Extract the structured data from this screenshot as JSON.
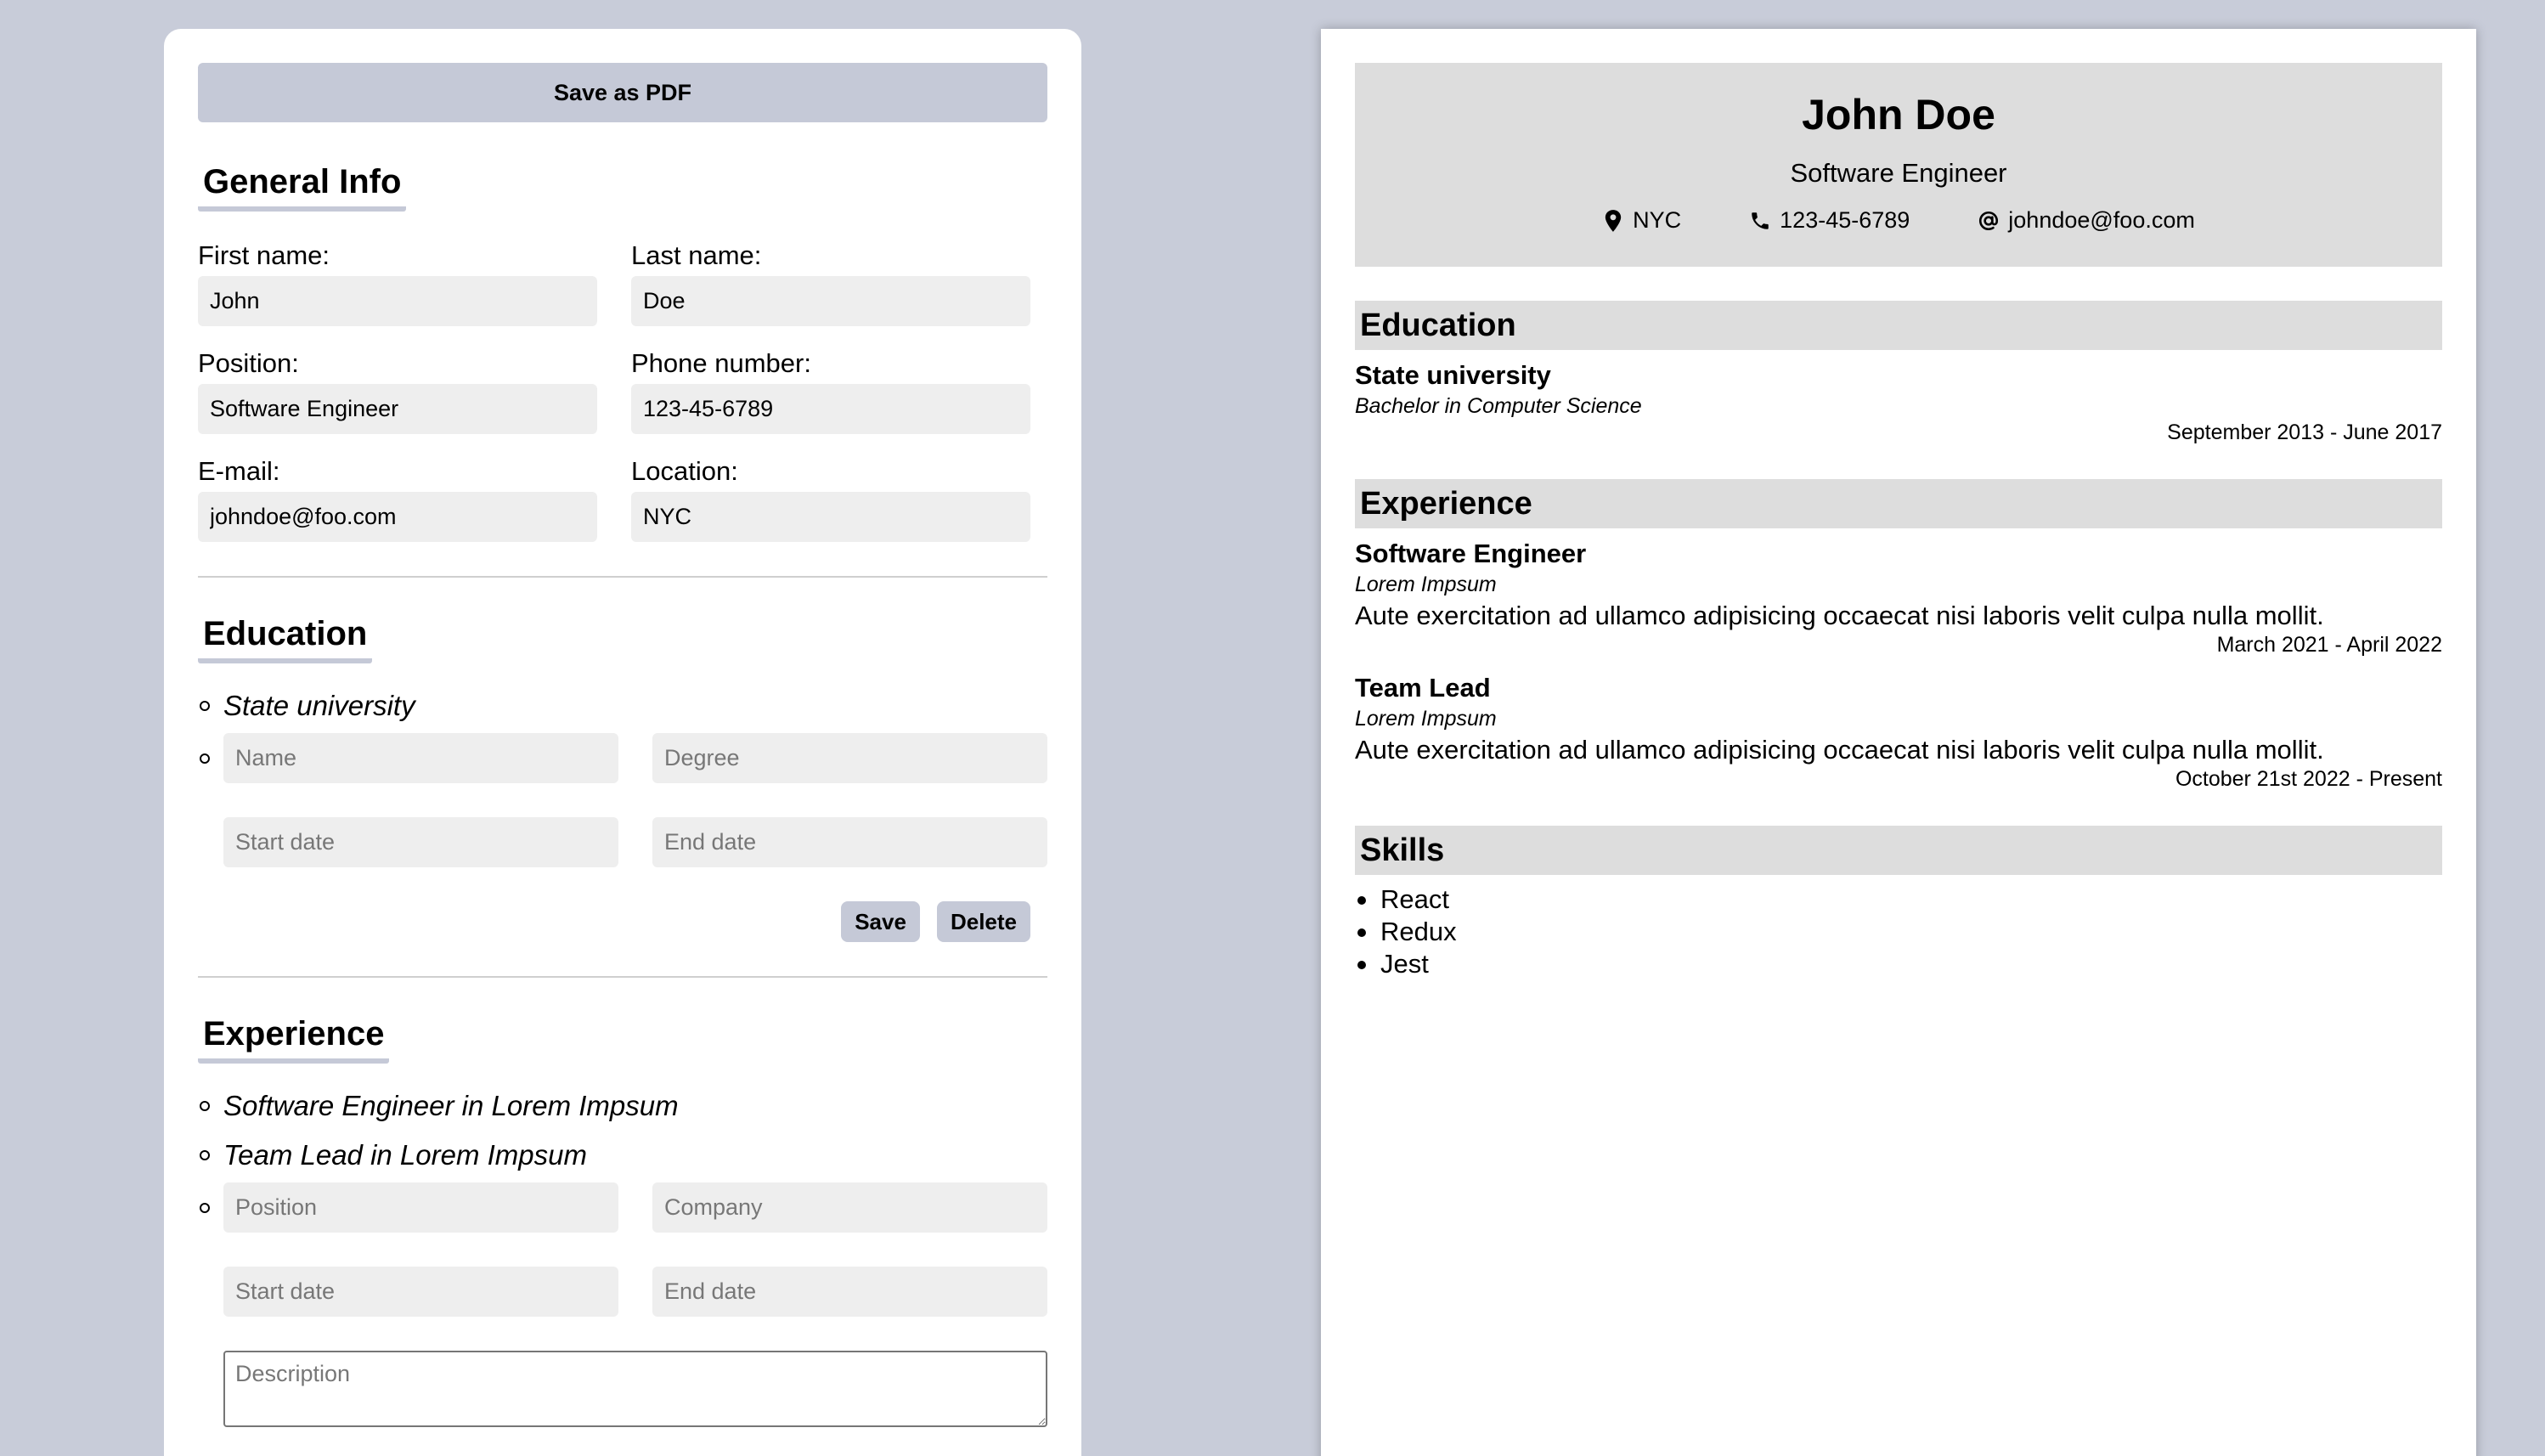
{
  "editor": {
    "save_pdf_label": "Save as PDF",
    "general": {
      "title": "General Info",
      "first_name": {
        "label": "First name:",
        "value": "John"
      },
      "last_name": {
        "label": "Last name:",
        "value": "Doe"
      },
      "position": {
        "label": "Position:",
        "value": "Software Engineer"
      },
      "phone": {
        "label": "Phone number:",
        "value": "123-45-6789"
      },
      "email": {
        "label": "E-mail:",
        "value": "johndoe@foo.com"
      },
      "location": {
        "label": "Location:",
        "value": "NYC"
      }
    },
    "education": {
      "title": "Education",
      "items": [
        "State university"
      ],
      "form": {
        "name_placeholder": "Name",
        "degree_placeholder": "Degree",
        "start_placeholder": "Start date",
        "end_placeholder": "End date",
        "save_label": "Save",
        "delete_label": "Delete"
      }
    },
    "experience": {
      "title": "Experience",
      "items": [
        "Software Engineer in Lorem Impsum",
        "Team Lead in Lorem Impsum"
      ],
      "form": {
        "position_placeholder": "Position",
        "company_placeholder": "Company",
        "start_placeholder": "Start date",
        "end_placeholder": "End date",
        "description_placeholder": "Description"
      }
    }
  },
  "cv": {
    "name": "John Doe",
    "position": "Software Engineer",
    "contacts": {
      "location": {
        "icon": "location-pin-icon",
        "text": "NYC"
      },
      "phone": {
        "icon": "phone-icon",
        "text": "123-45-6789"
      },
      "email": {
        "icon": "at-sign-icon",
        "text": "johndoe@foo.com"
      }
    },
    "education": {
      "title": "Education",
      "entries": [
        {
          "title": "State university",
          "subtitle": "Bachelor in Computer Science",
          "dates": "September 2013 - June 2017"
        }
      ]
    },
    "experience": {
      "title": "Experience",
      "entries": [
        {
          "title": "Software Engineer",
          "subtitle": "Lorem Impsum",
          "description": "Aute exercitation ad ullamco adipisicing occaecat nisi laboris velit culpa nulla mollit.",
          "dates": "March 2021 - April 2022"
        },
        {
          "title": "Team Lead",
          "subtitle": "Lorem Impsum",
          "description": "Aute exercitation ad ullamco adipisicing occaecat nisi laboris velit culpa nulla mollit.",
          "dates": "October 21st 2022 - Present"
        }
      ]
    },
    "skills": {
      "title": "Skills",
      "items": [
        "React",
        "Redux",
        "Jest"
      ]
    }
  },
  "colors": {
    "page_background": "#c8ccd9",
    "accent": "#c5c9d7",
    "input_background": "#eeeeee",
    "cv_band": "#dddddd"
  }
}
